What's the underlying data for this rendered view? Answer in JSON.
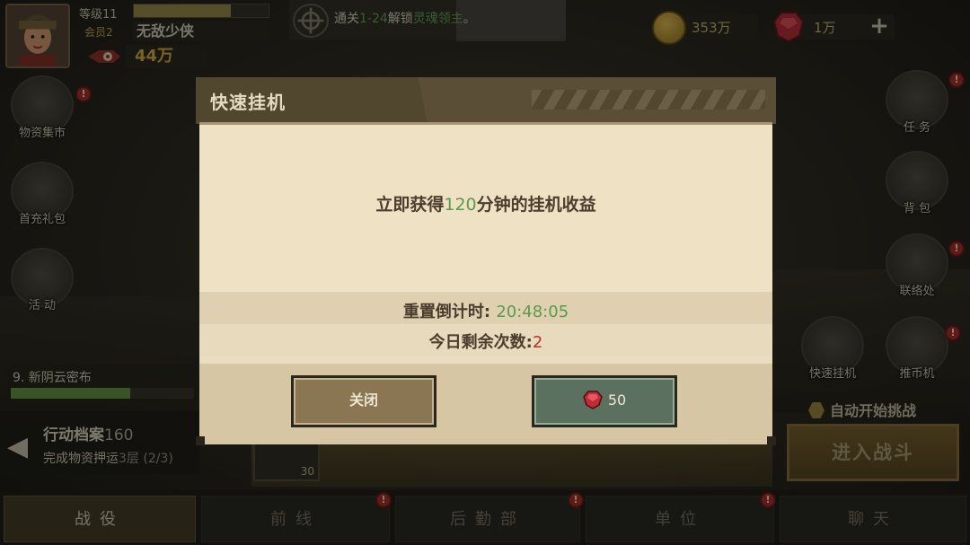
{
  "player": {
    "level_label": "等级11",
    "vip_label": "会员2",
    "name": "无敌少侠",
    "power": "44万",
    "xp_fraction": 0.72
  },
  "quest": {
    "prefix": "通关",
    "stage": "1-24",
    "middle": "解锁",
    "target": "灵魂领主",
    "suffix": "。"
  },
  "currency": {
    "gold": "353万",
    "gems": "1万",
    "plus": "+"
  },
  "left_buttons": [
    {
      "label": "物资集市",
      "alert": "!"
    },
    {
      "label": "首充礼包",
      "alert": ""
    },
    {
      "label": "活  动",
      "alert": ""
    }
  ],
  "right_buttons": [
    {
      "label": "任  务",
      "alert": "!"
    },
    {
      "label": "背  包",
      "alert": ""
    },
    {
      "label": "联络处",
      "alert": "!"
    },
    {
      "label": "快速挂机",
      "alert": ""
    },
    {
      "label": "推币机",
      "alert": "!"
    }
  ],
  "stage": {
    "name": "9. 新阴云密布",
    "progress": 0.65
  },
  "mission": {
    "title": "行动档案",
    "title_num": "160",
    "sub": "完成物资押运",
    "sub_floor": "3层",
    "sub_count": "(2/3)"
  },
  "loot": {
    "count": "30"
  },
  "battle": {
    "auto_label": "自动开始挑战",
    "enter_label": "进入战斗"
  },
  "nav": [
    {
      "label": "战役",
      "alert": ""
    },
    {
      "label": "前线",
      "alert": "!"
    },
    {
      "label": "后勤部",
      "alert": "!"
    },
    {
      "label": "单位",
      "alert": "!"
    },
    {
      "label": "聊天",
      "alert": ""
    }
  ],
  "modal": {
    "title": "快速挂机",
    "reward_prefix": "立即获得",
    "reward_minutes": "120",
    "reward_suffix": "分钟的挂机收益",
    "reset_label": "重置倒计时:",
    "reset_time": "20:48:05",
    "remaining_label": "今日剩余次数:",
    "remaining_count": "2",
    "close_label": "关闭",
    "buy_cost": "50"
  },
  "colors": {
    "highlight_green": "#5d9a4d",
    "highlight_red": "#b0352a",
    "gold": "#c9a23a"
  }
}
